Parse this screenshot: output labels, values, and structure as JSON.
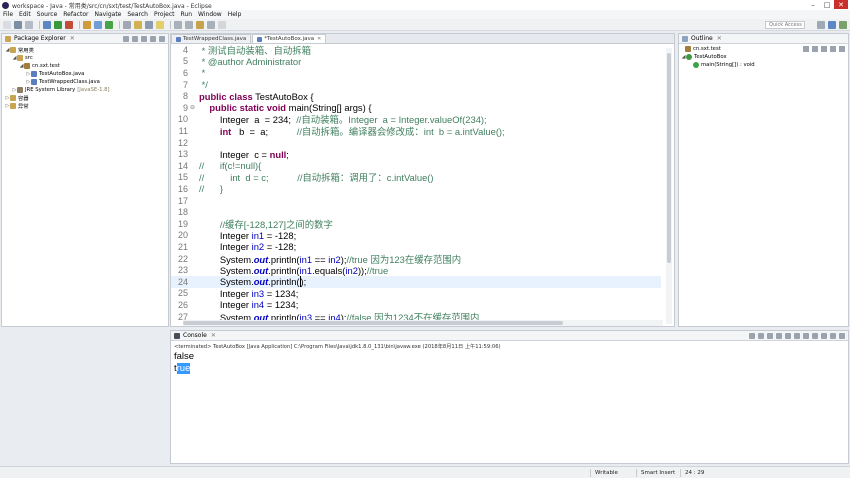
{
  "window": {
    "title": "workspace - Java - 常用类/src/cn/sxt/test/TestAutoBox.java - Eclipse"
  },
  "menu": [
    "File",
    "Edit",
    "Source",
    "Refactor",
    "Navigate",
    "Search",
    "Project",
    "Run",
    "Window",
    "Help"
  ],
  "quick_access": {
    "placeholder": "Quick Access"
  },
  "package_explorer": {
    "title": "Package Explorer",
    "tree": [
      {
        "label": "常用类",
        "extra": ""
      },
      {
        "label": "src",
        "extra": ""
      },
      {
        "label": "cn.sxt.test",
        "extra": ""
      },
      {
        "label": "TestAutoBox.java",
        "extra": ""
      },
      {
        "label": "TestWrappedClass.java",
        "extra": ""
      },
      {
        "label": "JRE System Library",
        "extra": "[JavaSE-1.8]"
      },
      {
        "label": "容器",
        "extra": ""
      },
      {
        "label": "异常",
        "extra": ""
      }
    ]
  },
  "editor": {
    "tabs": [
      {
        "label": "TestWrappedClass.java"
      },
      {
        "label": "*TestAutoBox.java"
      }
    ],
    "lines": [
      {
        "num": "4",
        "fold": "",
        "parts": [
          [
            "",
            " "
          ],
          [
            "cm",
            "* 测试自动装箱、自动拆箱"
          ]
        ]
      },
      {
        "num": "5",
        "fold": "",
        "parts": [
          [
            "",
            " "
          ],
          [
            "cm",
            "* @author Administrator"
          ]
        ]
      },
      {
        "num": "6",
        "fold": "",
        "parts": [
          [
            "",
            " "
          ],
          [
            "cm",
            "*"
          ]
        ]
      },
      {
        "num": "7",
        "fold": "",
        "parts": [
          [
            "",
            " "
          ],
          [
            "cm",
            "*/"
          ]
        ]
      },
      {
        "num": "8",
        "fold": "",
        "parts": [
          [
            "kw",
            "public"
          ],
          [
            "",
            " "
          ],
          [
            "kw",
            "class"
          ],
          [
            "",
            " TestAutoBox {"
          ]
        ]
      },
      {
        "num": "9",
        "fold": "⊖",
        "parts": [
          [
            "",
            "    "
          ],
          [
            "kw",
            "public"
          ],
          [
            "",
            " "
          ],
          [
            "kw",
            "static"
          ],
          [
            "",
            " "
          ],
          [
            "kw",
            "void"
          ],
          [
            "",
            " main(String[] args) {"
          ]
        ]
      },
      {
        "num": "10",
        "fold": "",
        "parts": [
          [
            "",
            "        Integer  a  = 234;  "
          ],
          [
            "cm",
            "//自动装箱。Integer  a = Integer.valueOf(234);"
          ]
        ]
      },
      {
        "num": "11",
        "fold": "",
        "parts": [
          [
            "",
            "        "
          ],
          [
            "kw",
            "int"
          ],
          [
            "",
            "   b  =  a;           "
          ],
          [
            "cm",
            "//自动拆箱。编译器会修改成：int  b = a.intValue();"
          ]
        ]
      },
      {
        "num": "12",
        "fold": "",
        "parts": [
          [
            "",
            " "
          ]
        ]
      },
      {
        "num": "13",
        "fold": "",
        "parts": [
          [
            "",
            "        Integer  c = "
          ],
          [
            "kw",
            "null"
          ],
          [
            "",
            ";"
          ]
        ]
      },
      {
        "num": "14",
        "fold": "",
        "parts": [
          [
            "cm",
            "//"
          ],
          [
            "",
            "      "
          ],
          [
            "cm",
            "if(c!=null){"
          ]
        ]
      },
      {
        "num": "15",
        "fold": "",
        "parts": [
          [
            "cm",
            "//"
          ],
          [
            "",
            "          "
          ],
          [
            "cm",
            "int  d = c;           //自动拆箱：调用了：c.intValue()"
          ]
        ]
      },
      {
        "num": "16",
        "fold": "",
        "parts": [
          [
            "cm",
            "//"
          ],
          [
            "",
            "      "
          ],
          [
            "cm",
            "}"
          ]
        ]
      },
      {
        "num": "17",
        "fold": "",
        "parts": [
          [
            "",
            " "
          ]
        ]
      },
      {
        "num": "18",
        "fold": "",
        "parts": [
          [
            "",
            " "
          ]
        ]
      },
      {
        "num": "19",
        "fold": "",
        "parts": [
          [
            "",
            "        "
          ],
          [
            "cm",
            "//缓存[-128,127]之间的数字"
          ]
        ]
      },
      {
        "num": "20",
        "fold": "",
        "parts": [
          [
            "",
            "        Integer "
          ],
          [
            "fd",
            "in1"
          ],
          [
            "",
            " = -128;"
          ]
        ]
      },
      {
        "num": "21",
        "fold": "",
        "parts": [
          [
            "",
            "        Integer "
          ],
          [
            "fd",
            "in2"
          ],
          [
            "",
            " = -128;"
          ]
        ]
      },
      {
        "num": "22",
        "fold": "",
        "parts": [
          [
            "",
            "        System."
          ],
          [
            "st",
            "out"
          ],
          [
            "",
            ".println("
          ],
          [
            "fd",
            "in1"
          ],
          [
            "",
            " == "
          ],
          [
            "fd",
            "in2"
          ],
          [
            "",
            ");"
          ],
          [
            "cm",
            "//true 因为123在缓存范围内"
          ]
        ]
      },
      {
        "num": "23",
        "fold": "",
        "parts": [
          [
            "",
            "        System."
          ],
          [
            "st",
            "out"
          ],
          [
            "",
            ".println("
          ],
          [
            "fd",
            "in1"
          ],
          [
            "",
            ".equals("
          ],
          [
            "fd",
            "in2"
          ],
          [
            "",
            "));"
          ],
          [
            "cm",
            "//true"
          ]
        ]
      },
      {
        "num": "24",
        "fold": "",
        "current": true,
        "parts": [
          [
            "",
            "        System."
          ],
          [
            "st",
            "out"
          ],
          [
            "",
            ".println("
          ],
          [
            "cursor",
            ""
          ],
          [
            "",
            ");"
          ]
        ]
      },
      {
        "num": "25",
        "fold": "",
        "parts": [
          [
            "",
            "        Integer "
          ],
          [
            "fd",
            "in3"
          ],
          [
            "",
            " = 1234;"
          ]
        ]
      },
      {
        "num": "26",
        "fold": "",
        "parts": [
          [
            "",
            "        Integer "
          ],
          [
            "fd",
            "in4"
          ],
          [
            "",
            " = 1234;"
          ]
        ]
      },
      {
        "num": "27",
        "fold": "",
        "parts": [
          [
            "",
            "        System."
          ],
          [
            "st",
            "out"
          ],
          [
            "",
            ".println("
          ],
          [
            "fd",
            "in3"
          ],
          [
            "",
            " == "
          ],
          [
            "fd",
            "in4"
          ],
          [
            "",
            ");"
          ],
          [
            "cm",
            "//false 因为1234不在缓存范围内"
          ]
        ]
      }
    ]
  },
  "outline": {
    "title": "Outline",
    "tree": [
      {
        "label": "cn.sxt.test"
      },
      {
        "label": "TestAutoBox"
      },
      {
        "label": "main(String[]) : void"
      }
    ]
  },
  "console": {
    "title": "Console",
    "status": "<terminated> TestAutoBox [Java Application] C:\\Program Files\\Java\\jdk1.8.0_131\\bin\\javaw.exe (2018年8月11日 上午11:59:06)",
    "output_line1": "false",
    "output_line2_plain": "t",
    "output_line2_selected": "rue"
  },
  "statusbar": {
    "writable": "Writable",
    "insert_mode": "Smart Insert",
    "position": "24 : 29"
  },
  "colors": {
    "keyword": "#7f0055",
    "comment": "#3f7f5f",
    "field": "#0000c0",
    "selection": "#3399ff"
  }
}
